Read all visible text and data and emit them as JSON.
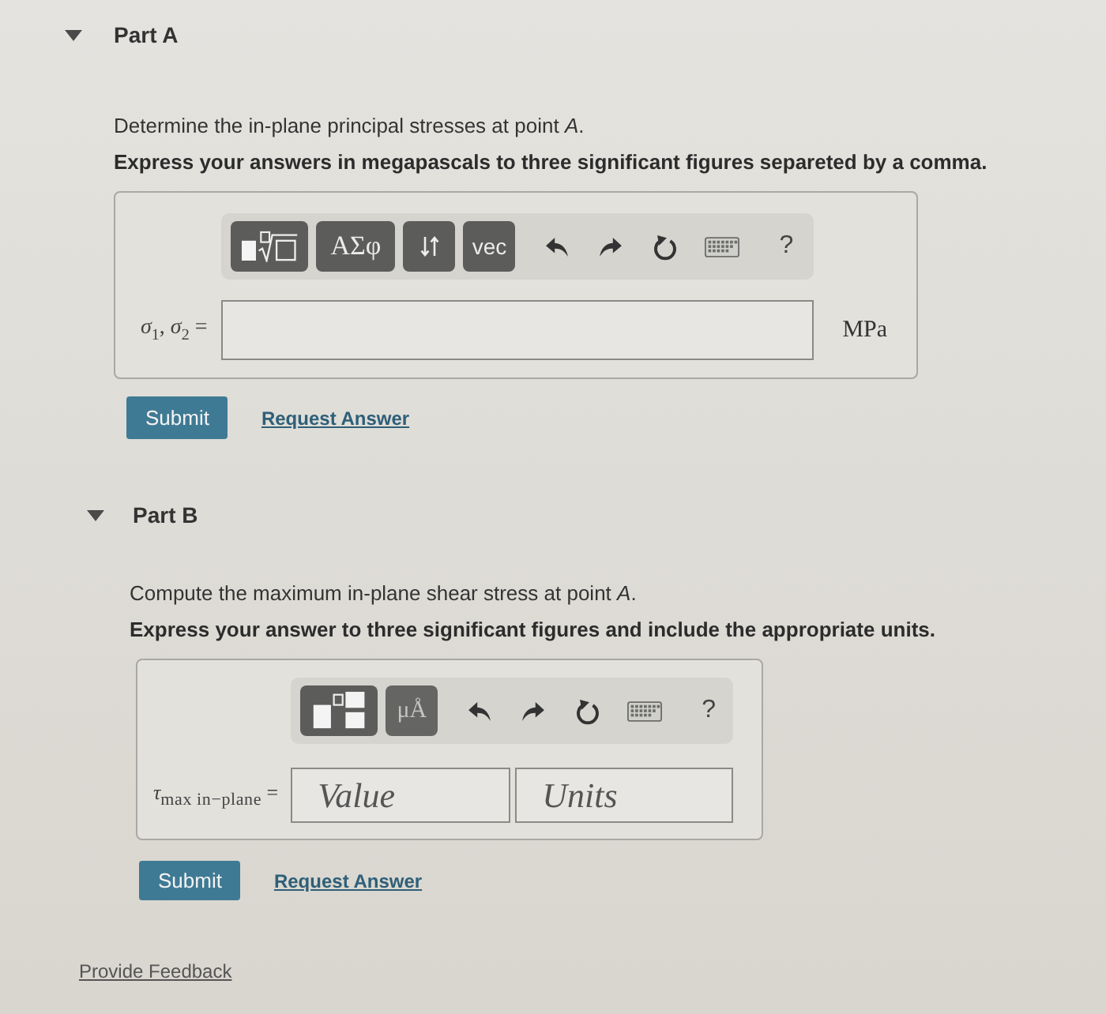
{
  "parts": [
    {
      "title": "Part A",
      "expanded": true,
      "prompt": "Determine the in-plane principal stresses at point *A*.",
      "instruction": "Express your answers in megapascals to three significant figures separeted by a comma.",
      "toolbar": [
        {
          "kind": "templates"
        },
        {
          "kind": "symbols",
          "label": "ΑΣφ"
        },
        {
          "kind": "swap"
        },
        {
          "kind": "vector",
          "label": "vec"
        },
        {
          "kind": "undo"
        },
        {
          "kind": "redo"
        },
        {
          "kind": "reset"
        },
        {
          "kind": "keyboard"
        },
        {
          "kind": "help",
          "label": "?"
        }
      ],
      "answer_label": "*σ*$_{1}$, *σ*$_{2}$ =",
      "fields": [
        {
          "kind": "wide"
        }
      ],
      "units": "MPa",
      "submit": "Submit",
      "request_answer": "Request Answer"
    },
    {
      "title": "Part B",
      "expanded": true,
      "prompt": "Compute the maximum in-plane shear stress at point *A*.",
      "instruction": "Express your answer to three significant figures and include the appropriate units.",
      "toolbar": [
        {
          "kind": "fraction_templates"
        },
        {
          "kind": "units",
          "label": "μÅ"
        },
        {
          "kind": "undo"
        },
        {
          "kind": "redo"
        },
        {
          "kind": "reset"
        },
        {
          "kind": "keyboard"
        },
        {
          "kind": "help",
          "label": "?"
        }
      ],
      "answer_label": "*τ*$_{max in−plane}$ =",
      "fields": [
        {
          "kind": "value",
          "placeholder": "Value"
        },
        {
          "kind": "units",
          "placeholder": "Units"
        }
      ],
      "submit": "Submit",
      "request_answer": "Request Answer"
    }
  ],
  "feedback_link": "Provide Feedback"
}
